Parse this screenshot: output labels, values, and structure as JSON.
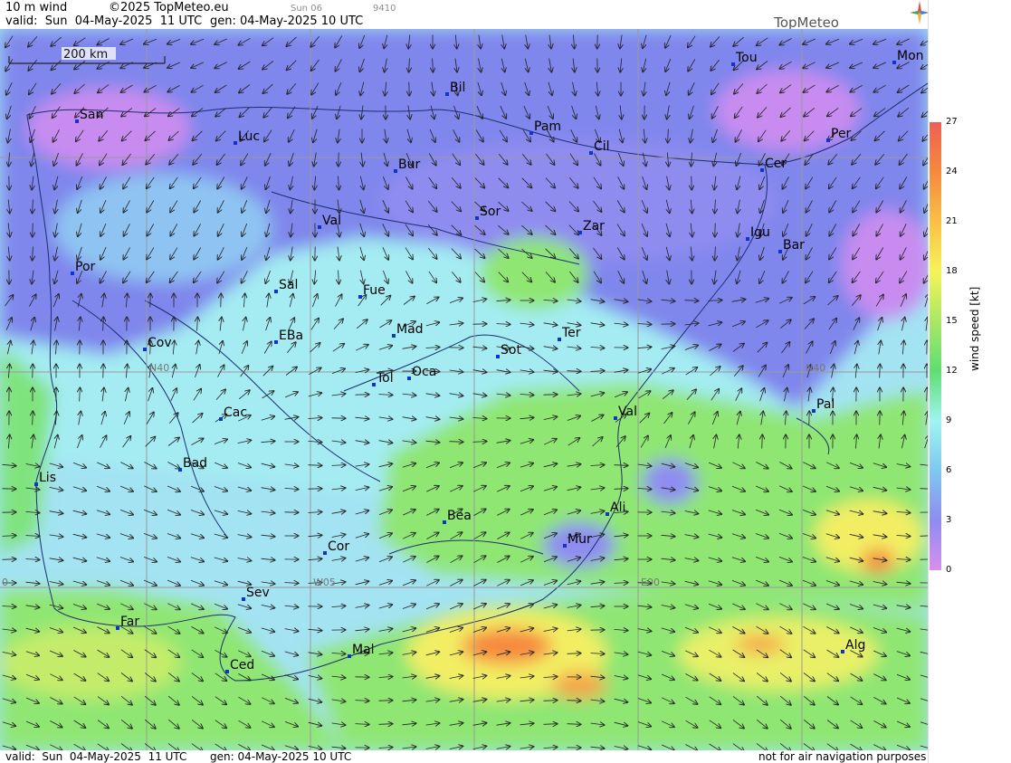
{
  "header": {
    "product": "10 m wind",
    "copyright": "©2025 TopMeteo.eu",
    "valid": "valid:  Sun  04-May-2025  11 UTC",
    "gen": "gen: 04-May-2025 10 UTC",
    "day_code": "Sun 06",
    "run_code": "9410",
    "brand": "TopMeteo"
  },
  "footer": {
    "valid": "valid:  Sun  04-May-2025  11 UTC",
    "gen": "gen: 04-May-2025 10 UTC",
    "disclaimer": "not for air navigation purposes"
  },
  "scale_bar": "200 km",
  "grid_labels": [
    "N40",
    "N40",
    "W05",
    "E00",
    "0"
  ],
  "legend": {
    "unit": "wind speed  [kt]",
    "ticks": [
      "27",
      "24",
      "21",
      "18",
      "15",
      "12",
      "9",
      "6",
      "3",
      "0"
    ],
    "colors": [
      "#f05f55",
      "#f6893f",
      "#fabf47",
      "#f6f35a",
      "#a9e865",
      "#5fde73",
      "#a0f4f0",
      "#7fc7f0",
      "#8f8cf0",
      "#d78fef"
    ]
  },
  "cities": [
    {
      "name": "San"
    },
    {
      "name": "Luc"
    },
    {
      "name": "Bil"
    },
    {
      "name": "Pam"
    },
    {
      "name": "Cil"
    },
    {
      "name": "Tou"
    },
    {
      "name": "Mon"
    },
    {
      "name": "Per"
    },
    {
      "name": "Cer"
    },
    {
      "name": "Bur"
    },
    {
      "name": "Sor"
    },
    {
      "name": "Zar"
    },
    {
      "name": "Val"
    },
    {
      "name": "Igu"
    },
    {
      "name": "Bar"
    },
    {
      "name": "Por"
    },
    {
      "name": "Sal"
    },
    {
      "name": "Fue"
    },
    {
      "name": "Mad"
    },
    {
      "name": "Cov"
    },
    {
      "name": "EBa"
    },
    {
      "name": "Sot"
    },
    {
      "name": "Ter"
    },
    {
      "name": "Tol"
    },
    {
      "name": "Oca"
    },
    {
      "name": "Cac"
    },
    {
      "name": "Val"
    },
    {
      "name": "Pal"
    },
    {
      "name": "Bad"
    },
    {
      "name": "Lis"
    },
    {
      "name": "Bea"
    },
    {
      "name": "Ali"
    },
    {
      "name": "Cor"
    },
    {
      "name": "Mur"
    },
    {
      "name": "Sev"
    },
    {
      "name": "Far"
    },
    {
      "name": "Mal"
    },
    {
      "name": "Ced"
    },
    {
      "name": "Alg"
    }
  ]
}
